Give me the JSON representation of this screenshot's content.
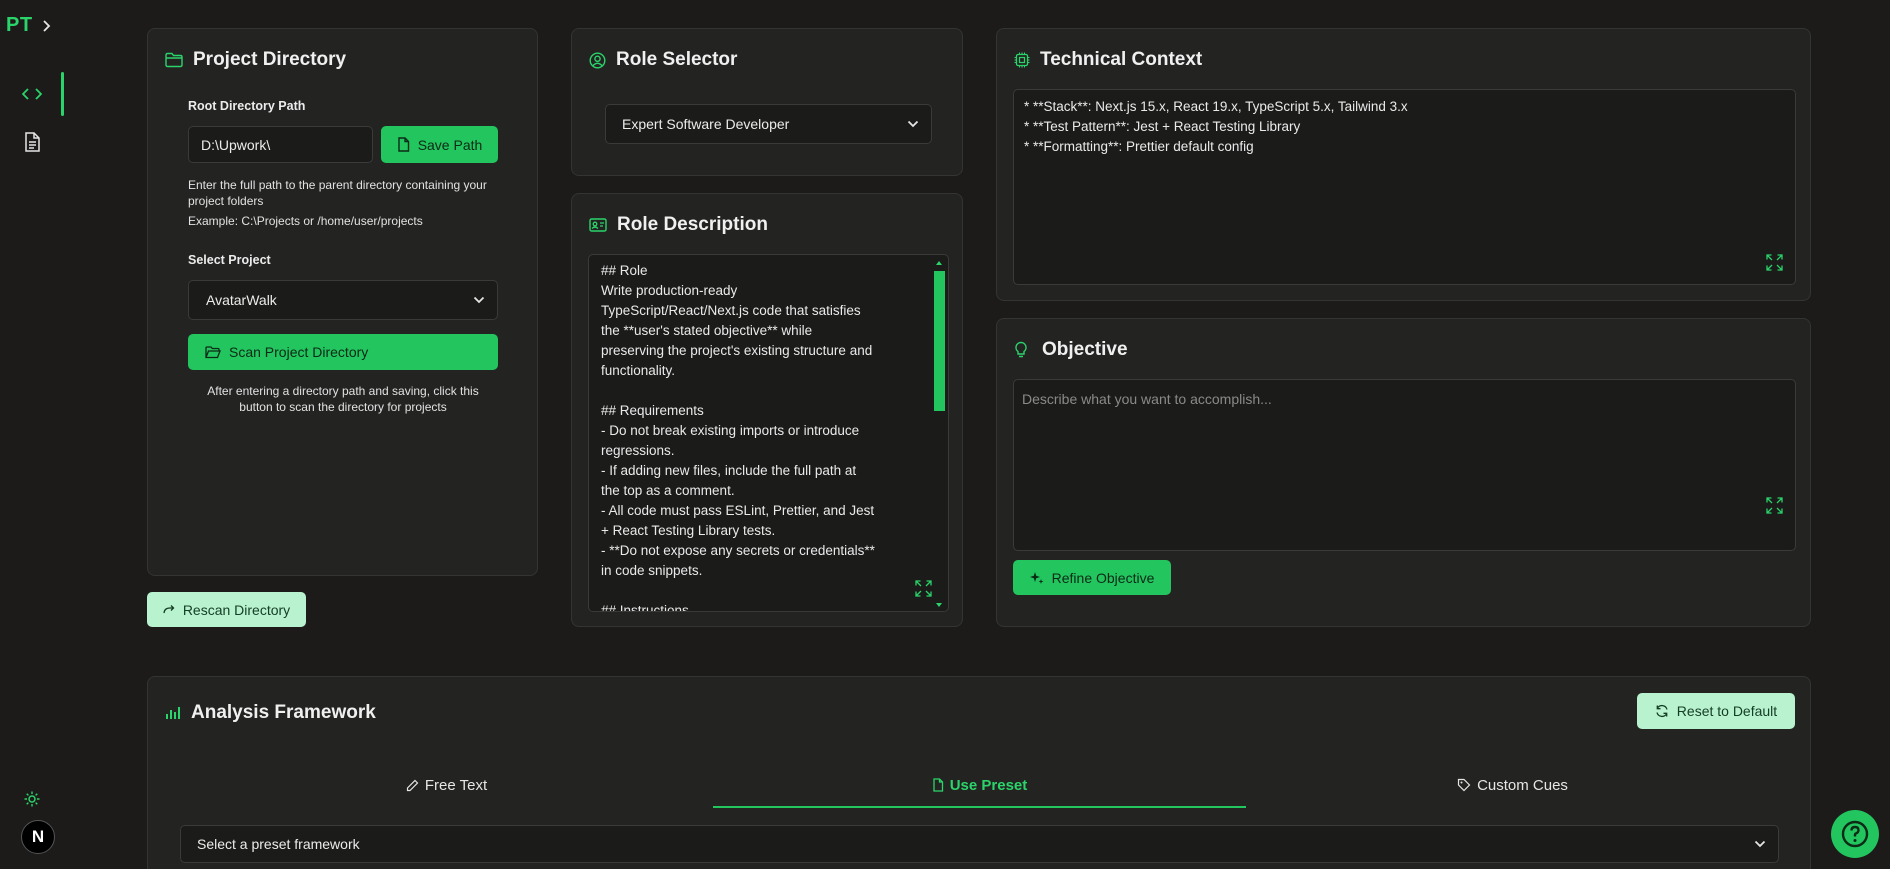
{
  "sidebar": {
    "logo": "PT",
    "items": [
      {
        "icon": "code-icon",
        "active": true
      },
      {
        "icon": "document-icon",
        "active": false
      }
    ],
    "theme_icon": "sun-icon",
    "avatar_letter": "N"
  },
  "project_directory": {
    "title": "Project Directory",
    "root_label": "Root Directory Path",
    "root_value": "D:\\Upwork\\",
    "save_button": "Save Path",
    "help_line1": "Enter the full path to the parent directory containing your",
    "help_line2": "project folders",
    "help_example": "Example: C:\\Projects or /home/user/projects",
    "select_label": "Select Project",
    "selected_project": "AvatarWalk",
    "scan_button": "Scan Project Directory",
    "scan_help_line1": "After entering a directory path and saving, click this",
    "scan_help_line2": "button to scan the directory for projects",
    "rescan_button": "Rescan Directory"
  },
  "role_selector": {
    "title": "Role Selector",
    "selected_role": "Expert Software Developer"
  },
  "role_description": {
    "title": "Role Description",
    "lines": [
      "## Role",
      "Write production-ready",
      "TypeScript/React/Next.js code that satisfies",
      "the **user's stated objective** while",
      "preserving the project's existing structure and",
      "functionality.",
      "",
      "## Requirements",
      "- Do not break existing imports or introduce",
      "regressions.",
      "- If adding new files, include the full path at",
      "the top as a comment.",
      "- All code must pass ESLint, Prettier, and Jest",
      "+ React Testing Library tests.",
      "- **Do not expose any secrets or credentials**",
      "in code snippets.",
      "",
      "## Instructions"
    ]
  },
  "technical_context": {
    "title": "Technical Context",
    "lines": [
      "* **Stack**: Next.js 15.x, React 19.x, TypeScript 5.x, Tailwind 3.x",
      "* **Test Pattern**: Jest + React Testing Library",
      "* **Formatting**: Prettier default config"
    ]
  },
  "objective": {
    "title": "Objective",
    "placeholder": "Describe what you want to accomplish...",
    "refine_button": "Refine Objective"
  },
  "analysis_framework": {
    "title": "Analysis Framework",
    "reset_button": "Reset to Default",
    "tabs": [
      {
        "label": "Free Text",
        "icon": "pencil-icon",
        "active": false
      },
      {
        "label": "Use Preset",
        "icon": "file-icon",
        "active": true
      },
      {
        "label": "Custom Cues",
        "icon": "tag-icon",
        "active": false
      }
    ],
    "preset_placeholder": "Select a preset framework"
  },
  "colors": {
    "accent": "#22c55e",
    "background": "#1c1b1a",
    "card": "#232322"
  }
}
